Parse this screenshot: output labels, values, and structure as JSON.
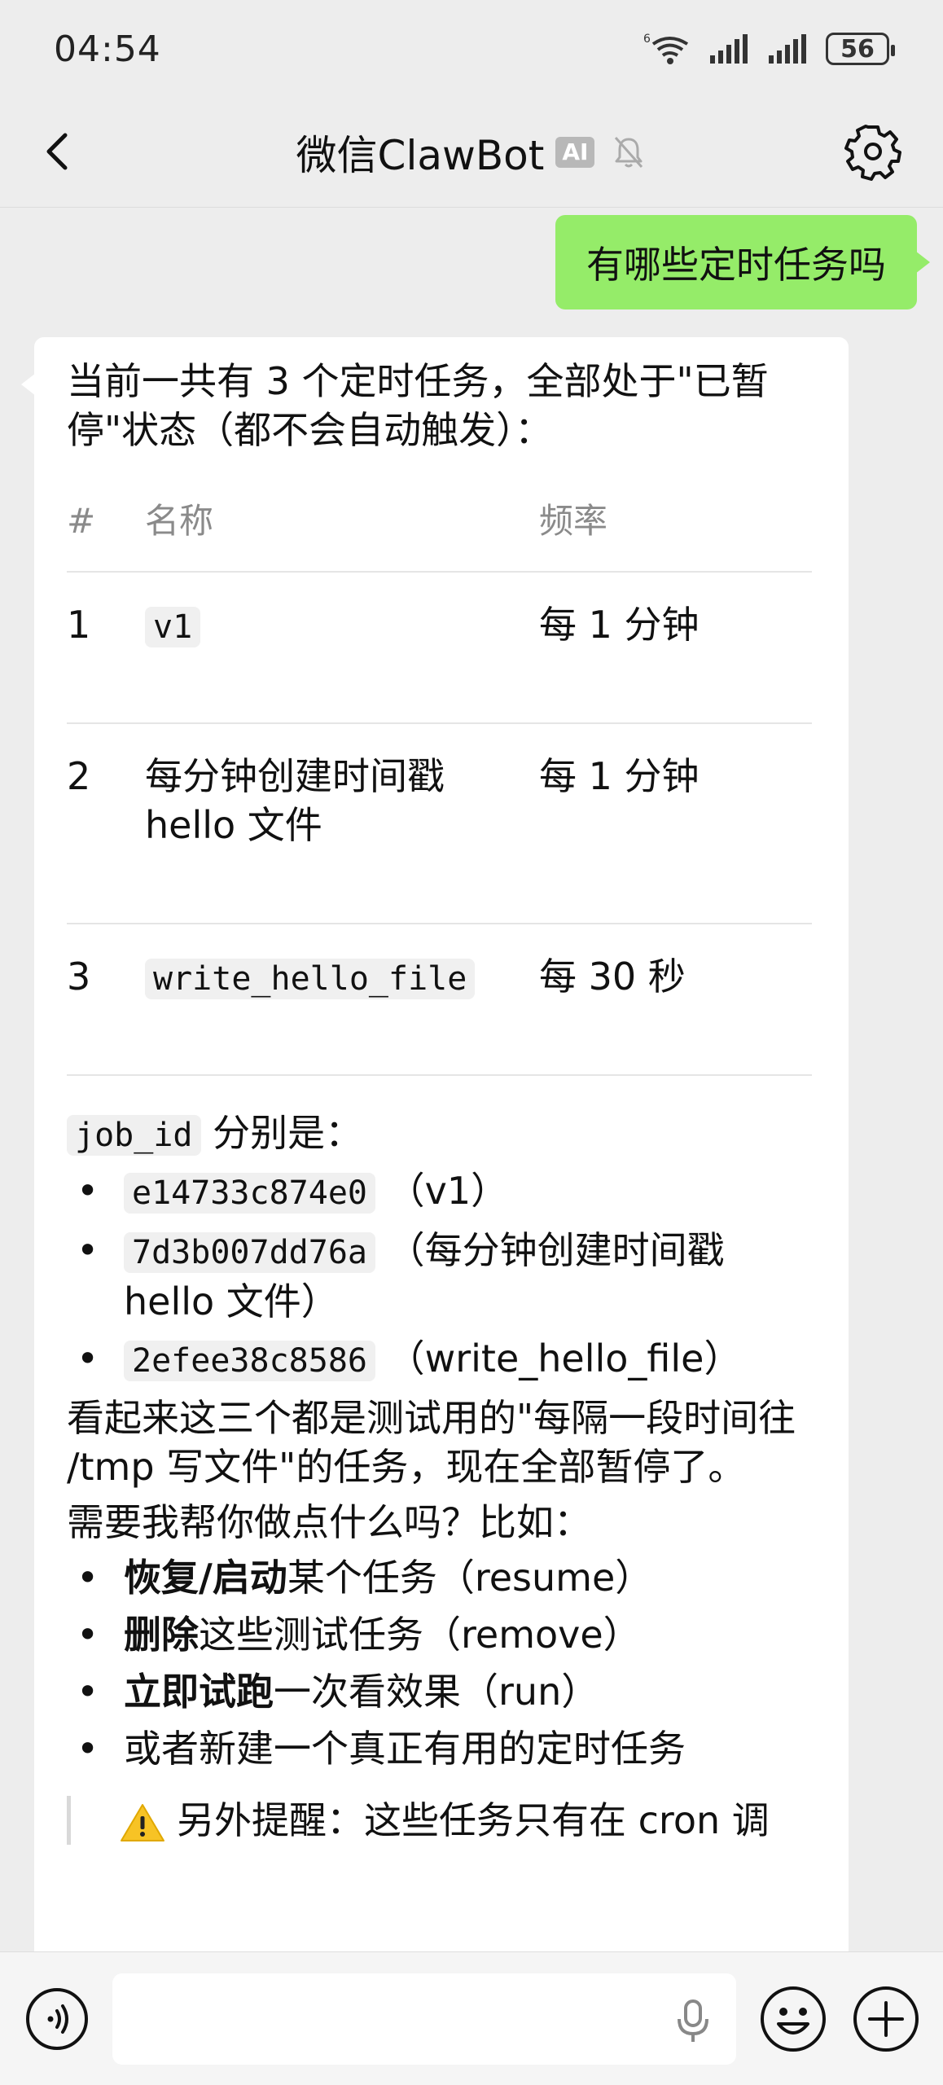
{
  "status_bar": {
    "time": "04:54",
    "battery": "56",
    "wifi_sup": "6"
  },
  "nav": {
    "title": "微信ClawBot",
    "badge": "AI"
  },
  "chat": {
    "user_message": "有哪些定时任务吗",
    "bot": {
      "intro": "当前一共有 3 个定时任务，全部处于\"已暂停\"状态（都不会自动触发）：",
      "table": {
        "headers": [
          "#",
          "名称",
          "频率"
        ],
        "rows": [
          {
            "num": "1",
            "name": "v1",
            "name_is_code": true,
            "freq": "每 1 分钟"
          },
          {
            "num": "2",
            "name": "每分钟创建时间戳 hello 文件",
            "name_is_code": false,
            "freq": "每 1 分钟"
          },
          {
            "num": "3",
            "name": "write_hello_file",
            "name_is_code": true,
            "freq": "每 30 秒"
          }
        ]
      },
      "jobid_code": "job_id",
      "jobid_suffix": " 分别是：",
      "job_ids": [
        {
          "id": "e14733c874e0",
          "desc": "（v1）"
        },
        {
          "id": "7d3b007dd76a",
          "desc": "（每分钟创建时间戳 hello 文件）"
        },
        {
          "id": "2efee38c8586",
          "desc": "（write_hello_file）"
        }
      ],
      "summary": "看起来这三个都是测试用的\"每隔一段时间往 /tmp 写文件\"的任务，现在全部暂停了。",
      "ask": "需要我帮你做点什么吗？比如：",
      "options": [
        {
          "bold": "恢复/启动",
          "rest": "某个任务（resume）"
        },
        {
          "bold": "删除",
          "rest": "这些测试任务（remove）"
        },
        {
          "bold": "立即试跑",
          "rest": "一次看效果（run）"
        },
        {
          "bold": "",
          "rest": "或者新建一个真正有用的定时任务"
        }
      ],
      "notice": "另外提醒：这些任务只有在 cron 调"
    }
  },
  "input": {
    "placeholder": ""
  },
  "colors": {
    "user_bubble": "#95ec69",
    "background": "#ededed"
  }
}
